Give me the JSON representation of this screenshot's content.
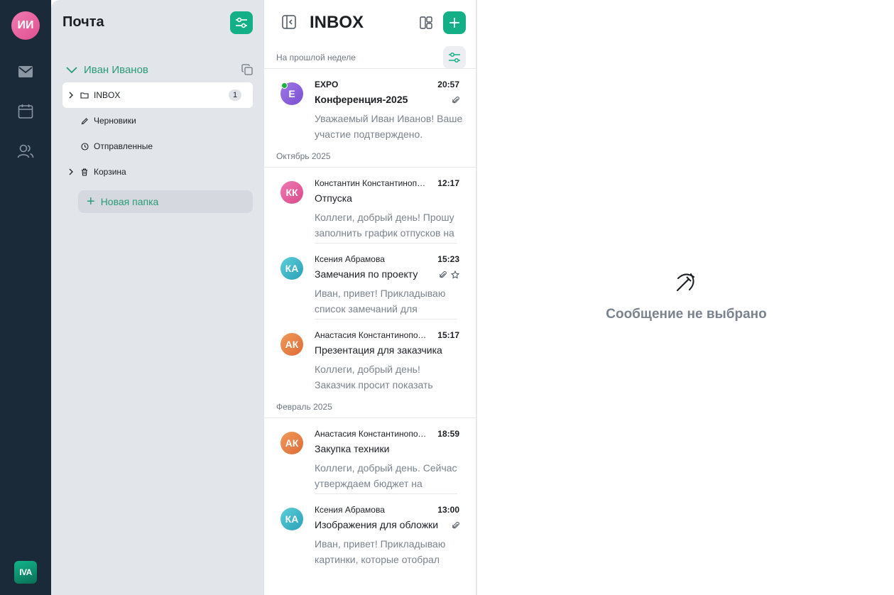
{
  "rail": {
    "user_initials": "ИИ",
    "logo_text": "IVA",
    "items": [
      {
        "icon": "mail-icon"
      },
      {
        "icon": "calendar-icon"
      },
      {
        "icon": "contacts-icon"
      }
    ]
  },
  "folders_panel": {
    "title": "Почта",
    "account_name": "Иван Иванов",
    "items": [
      {
        "label": "INBOX",
        "icon": "folder-icon",
        "badge": "1",
        "active": true,
        "expandable": true
      },
      {
        "label": "Черновики",
        "icon": "pencil-icon",
        "active": false,
        "expandable": false
      },
      {
        "label": "Отправленные",
        "icon": "clock-icon",
        "active": false,
        "expandable": false
      },
      {
        "label": "Корзина",
        "icon": "trash-icon",
        "active": false,
        "expandable": true
      }
    ],
    "new_folder_label": "Новая папка"
  },
  "message_list": {
    "title": "INBOX",
    "groups": [
      {
        "label": "На прошлой неделе",
        "messages": [
          {
            "initials": "E",
            "avatar_color": "#8a5cd8",
            "online": true,
            "from": "EXPO",
            "time": "20:57",
            "subject": "Конференция-2025",
            "unread": true,
            "attachment": true,
            "star": false,
            "preview": "Уважаемый Иван Иванов! Ваше участие подтверждено."
          }
        ]
      },
      {
        "label": "Октябрь 2025",
        "messages": [
          {
            "initials": "КК",
            "avatar_color": "#e0508f",
            "online": false,
            "from": "Константин Константинопольский",
            "time": "12:17",
            "subject": "Отпуска",
            "unread": false,
            "attachment": false,
            "star": false,
            "preview": "Коллеги, добрый день! Прошу заполнить график отпусков на"
          },
          {
            "initials": "КА",
            "avatar_color": "#2fb0c4",
            "online": false,
            "from": "Ксения Абрамова",
            "time": "15:23",
            "subject": "Замечания по проекту",
            "unread": false,
            "attachment": true,
            "star": true,
            "preview": "Иван, привет! Прикладываю список замечаний для"
          },
          {
            "initials": "АК",
            "avatar_color": "#e8763f",
            "online": false,
            "from": "Анастасия Константинопольская",
            "time": "15:17",
            "subject": "Презентация для заказчика",
            "unread": false,
            "attachment": false,
            "star": false,
            "preview": "Коллеги, добрый день! Заказчик просит показать"
          }
        ]
      },
      {
        "label": "Февраль 2025",
        "messages": [
          {
            "initials": "АК",
            "avatar_color": "#e8763f",
            "online": false,
            "from": "Анастасия Константинопольская",
            "time": "18:59",
            "subject": "Закупка техники",
            "unread": false,
            "attachment": false,
            "star": false,
            "preview": "Коллеги, добрый день. Сейчас утверждаем бюджет на"
          },
          {
            "initials": "КА",
            "avatar_color": "#2fb0c4",
            "online": false,
            "from": "Ксения Абрамова",
            "time": "13:00",
            "subject": "Изображения для обложки",
            "unread": false,
            "attachment": true,
            "star": false,
            "preview": "Иван, привет! Прикладываю картинки, которые отобрал"
          }
        ]
      }
    ]
  },
  "reader": {
    "empty_text": "Сообщение не выбрано",
    "empty_icon": "pickaxe-icon"
  },
  "colors": {
    "accent": "#13b087",
    "rail_bg": "#1b2a38",
    "panel_bg": "#e2e5ea"
  }
}
